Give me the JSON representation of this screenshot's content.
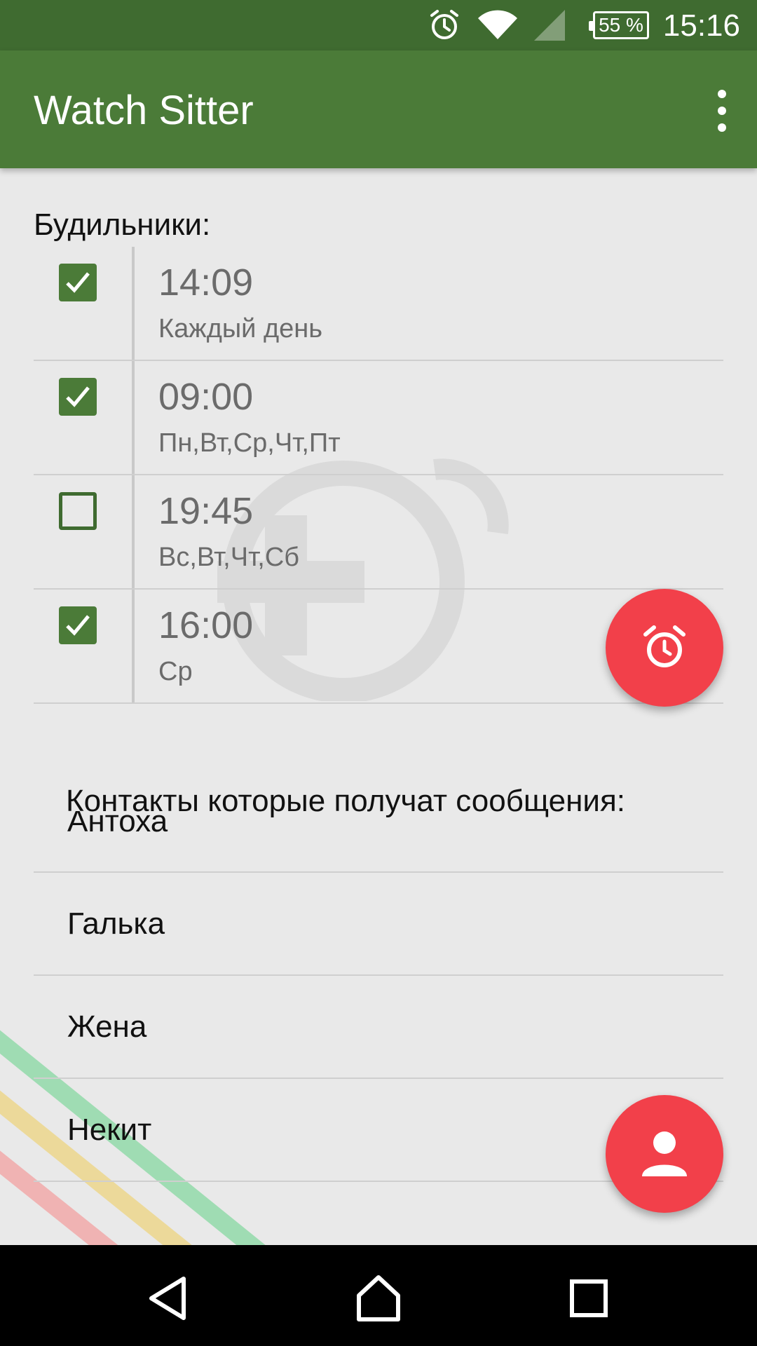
{
  "status_bar": {
    "time": "15:16",
    "battery": "55 %",
    "icons": [
      "alarm-icon",
      "wifi-icon",
      "signal-icon",
      "battery-icon"
    ]
  },
  "app_bar": {
    "title": "Watch Sitter",
    "menu_icon": "overflow-menu-icon"
  },
  "alarms": {
    "title": "Будильники:",
    "items": [
      {
        "time": "14:09",
        "days": "Каждый день",
        "enabled": true
      },
      {
        "time": "09:00",
        "days": "Пн,Вт,Ср,Чт,Пт",
        "enabled": true
      },
      {
        "time": "19:45",
        "days": "Вс,Вт,Чт,Сб",
        "enabled": false
      },
      {
        "time": "16:00",
        "days": "Ср",
        "enabled": true
      }
    ]
  },
  "contacts": {
    "title": "Контакты которые получат сообщения:",
    "items": [
      {
        "name": "Антоха"
      },
      {
        "name": "Галька"
      },
      {
        "name": "Жена"
      },
      {
        "name": "Некит"
      }
    ]
  },
  "fabs": {
    "add_alarm_icon": "alarm-clock-icon",
    "add_contact_icon": "person-icon"
  },
  "colors": {
    "primary": "#4b7b38",
    "primary_dark": "#3f6b30",
    "accent": "#f2404a",
    "background": "#e9e9e9"
  }
}
